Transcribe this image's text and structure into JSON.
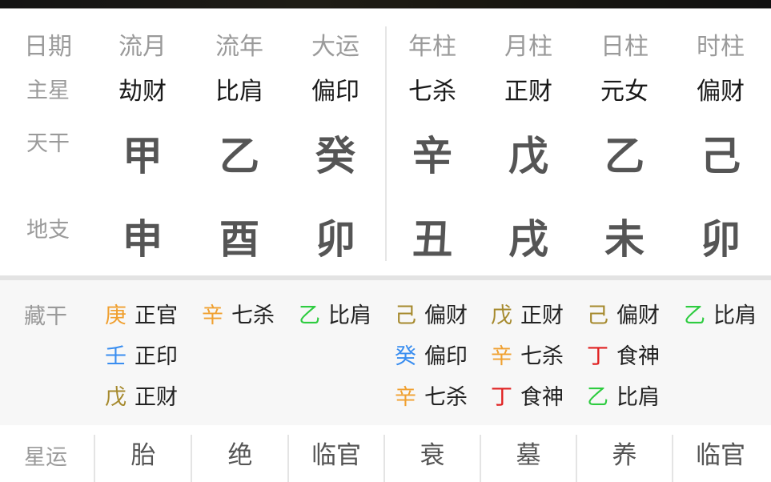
{
  "colors": {
    "header_text": "#9a9a9a",
    "star_text": "#1a1a1a",
    "pillar_text": "#555555",
    "element_metal": "#f0a030",
    "element_water": "#3a8ef0",
    "element_earth": "#a68a2e",
    "element_wood": "#2ecc40",
    "element_fire": "#e02020"
  },
  "header": {
    "row_label": "日期",
    "columns": [
      "流月",
      "流年",
      "大运",
      "年柱",
      "月柱",
      "日柱",
      "时柱"
    ]
  },
  "main_star": {
    "label": "主星",
    "values": [
      "劫财",
      "比肩",
      "偏印",
      "七杀",
      "正财",
      "元女",
      "偏财"
    ]
  },
  "heavenly_stems": {
    "label": "天干",
    "values": [
      "甲",
      "乙",
      "癸",
      "辛",
      "戊",
      "乙",
      "己"
    ]
  },
  "earthly_branches": {
    "label": "地支",
    "values": [
      "申",
      "酉",
      "卯",
      "丑",
      "戌",
      "未",
      "卯"
    ]
  },
  "hidden_stems": {
    "label": "藏干",
    "columns": [
      [
        {
          "stem": "庚",
          "god": "正官",
          "element": "metal"
        },
        {
          "stem": "壬",
          "god": "正印",
          "element": "water"
        },
        {
          "stem": "戊",
          "god": "正财",
          "element": "earth"
        }
      ],
      [
        {
          "stem": "辛",
          "god": "七杀",
          "element": "metal"
        }
      ],
      [
        {
          "stem": "乙",
          "god": "比肩",
          "element": "wood"
        }
      ],
      [
        {
          "stem": "己",
          "god": "偏财",
          "element": "earth"
        },
        {
          "stem": "癸",
          "god": "偏印",
          "element": "water"
        },
        {
          "stem": "辛",
          "god": "七杀",
          "element": "metal"
        }
      ],
      [
        {
          "stem": "戊",
          "god": "正财",
          "element": "earth"
        },
        {
          "stem": "辛",
          "god": "七杀",
          "element": "metal"
        },
        {
          "stem": "丁",
          "god": "食神",
          "element": "fire"
        }
      ],
      [
        {
          "stem": "己",
          "god": "偏财",
          "element": "earth"
        },
        {
          "stem": "丁",
          "god": "食神",
          "element": "fire"
        },
        {
          "stem": "乙",
          "god": "比肩",
          "element": "wood"
        }
      ],
      [
        {
          "stem": "乙",
          "god": "比肩",
          "element": "wood"
        }
      ]
    ]
  },
  "star_fortune": {
    "label": "星运",
    "values": [
      "胎",
      "绝",
      "临官",
      "衰",
      "墓",
      "养",
      "临官"
    ]
  }
}
